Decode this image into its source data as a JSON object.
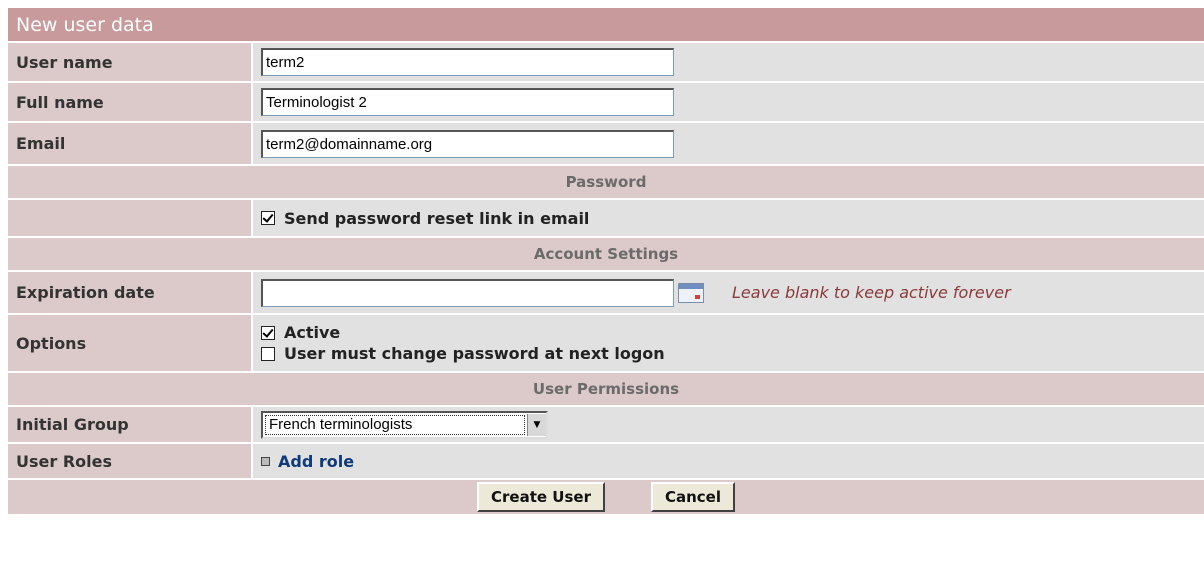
{
  "form": {
    "title": "New user data"
  },
  "fields": {
    "username": {
      "label": "User name",
      "value": "term2"
    },
    "fullname": {
      "label": "Full name",
      "value": "Terminologist 2"
    },
    "email": {
      "label": "Email",
      "value": "term2@domainname.org"
    }
  },
  "sections": {
    "password": "Password",
    "account": "Account Settings",
    "permissions": "User Permissions"
  },
  "password": {
    "send_reset": {
      "label": "Send password reset link in email",
      "checked": true
    }
  },
  "account": {
    "expiration": {
      "label": "Expiration date",
      "value": "",
      "hint": "Leave blank to keep active forever",
      "icon": "calendar-icon"
    },
    "options": {
      "label": "Options",
      "active": {
        "label": "Active",
        "checked": true
      },
      "must_change": {
        "label": "User must change password at next logon",
        "checked": false
      }
    }
  },
  "permissions": {
    "initial_group": {
      "label": "Initial Group",
      "selected": "French terminologists"
    },
    "roles": {
      "label": "User Roles",
      "add_label": "Add role"
    }
  },
  "buttons": {
    "create": "Create User",
    "cancel": "Cancel"
  }
}
